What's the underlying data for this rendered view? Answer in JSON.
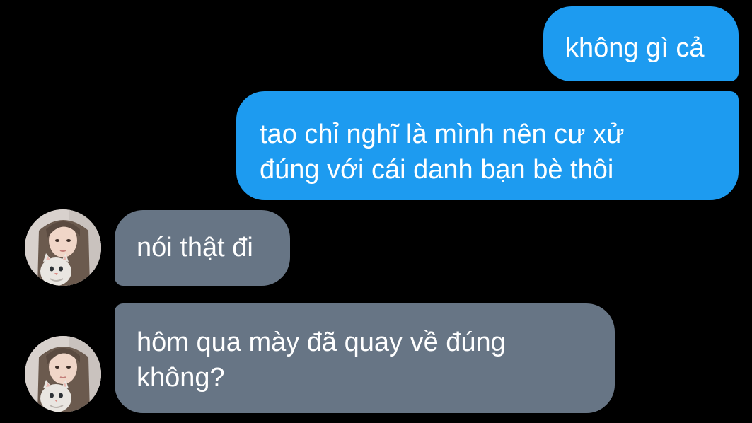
{
  "conversation": {
    "messages": [
      {
        "direction": "outgoing",
        "text": "không gì cả"
      },
      {
        "direction": "outgoing",
        "text": "tao chỉ nghĩ là mình nên cư xử\nđúng với cái danh bạn bè thôi"
      },
      {
        "direction": "incoming",
        "text": "nói thật đi"
      },
      {
        "direction": "incoming",
        "text": "hôm qua mày đã quay về đúng\nkhông?"
      }
    ]
  },
  "colors": {
    "background": "#000000",
    "outgoing_bubble": "#1d9bf0",
    "incoming_bubble": "#677585",
    "text": "#ffffff"
  },
  "icons": {
    "contact_avatar": "avatar-photo-girl-with-cat"
  }
}
